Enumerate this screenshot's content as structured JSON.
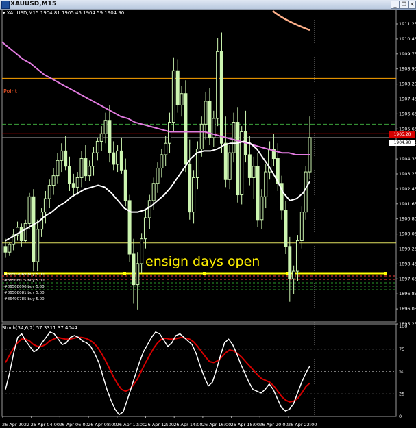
{
  "window": {
    "title": "XAUUSD,M15",
    "minimize_glyph": "_",
    "restore_glyph": "❐",
    "close_glyph": "✕"
  },
  "chart_header": "▾ XAUUSD,M15  1904.81 1905.45 1904.59 1904.90",
  "price_axis": [
    "1911.25",
    "1910.45",
    "1909.75",
    "1908.95",
    "1908.20",
    "1907.45",
    "1906.65",
    "1905.65",
    "1904.90",
    "1904.35",
    "1903.25",
    "1902.45",
    "1901.65",
    "1900.80",
    "1900.05",
    "1899.25",
    "1898.45",
    "1897.65",
    "1896.85",
    "1896.05",
    "1895.25"
  ],
  "current_price_tag": "1904.90",
  "red_price_tag": "1905.20",
  "point_label": "Point",
  "annotation": "ensign days open",
  "order_labels": [
    "#86502069 buy 5.00",
    "#86508075 buy 5.00",
    "#86508096 buy 5.00",
    "#86508081 buy 5.00",
    "#86490785 buy 5.00"
  ],
  "indicator_header": "Stoch(34,6,2) 57.3311 37.4044",
  "stoch_axis": [
    "100",
    "75",
    "50",
    "25",
    "0"
  ],
  "time_axis": [
    "26 Apr 2022",
    "26 Apr 04:00",
    "26 Apr 06:00",
    "26 Apr 08:00",
    "26 Apr 10:00",
    "26 Apr 12:00",
    "26 Apr 14:00",
    "26 Apr 16:00",
    "26 Apr 18:00",
    "26 Apr 20:00",
    "26 Apr 22:00"
  ],
  "colors": {
    "background": "#000000",
    "candle_body": "#ccf5b0",
    "ma_slow": "#e27be0",
    "ma_fast": "#ffffff",
    "trend": "#ffb08a",
    "level_orange": "#ffa500",
    "level_green": "#3ca23c",
    "stoch_main": "#ffffff",
    "stoch_signal": "#d40000",
    "annotation": "#fff000"
  },
  "chart_data": {
    "type": "candlestick",
    "symbol": "XAUUSD",
    "timeframe": "M15",
    "ylim": [
      1895.25,
      1911.6
    ],
    "candles": [
      [
        1899.2,
        1899.6,
        1898.6,
        1898.9
      ],
      [
        1898.9,
        1899.4,
        1898.7,
        1899.3
      ],
      [
        1899.3,
        1900.1,
        1899.0,
        1899.8
      ],
      [
        1899.8,
        1900.5,
        1899.5,
        1900.2
      ],
      [
        1900.2,
        1900.4,
        1899.2,
        1899.5
      ],
      [
        1899.5,
        1900.6,
        1899.4,
        1900.4
      ],
      [
        1900.4,
        1902.0,
        1900.1,
        1901.8
      ],
      [
        1901.8,
        1902.2,
        1897.9,
        1898.4
      ],
      [
        1898.4,
        1900.6,
        1897.9,
        1900.1
      ],
      [
        1900.1,
        1901.2,
        1899.7,
        1901.0
      ],
      [
        1901.0,
        1902.1,
        1900.4,
        1901.7
      ],
      [
        1901.7,
        1902.7,
        1901.2,
        1902.4
      ],
      [
        1902.4,
        1903.3,
        1901.9,
        1902.9
      ],
      [
        1902.9,
        1904.1,
        1902.5,
        1903.7
      ],
      [
        1903.7,
        1904.6,
        1903.1,
        1904.2
      ],
      [
        1904.2,
        1905.0,
        1903.2,
        1903.4
      ],
      [
        1903.4,
        1903.9,
        1902.1,
        1902.5
      ],
      [
        1902.5,
        1903.0,
        1901.8,
        1902.3
      ],
      [
        1902.3,
        1903.1,
        1901.9,
        1902.8
      ],
      [
        1902.8,
        1904.2,
        1902.3,
        1903.8
      ],
      [
        1903.8,
        1904.5,
        1902.6,
        1902.9
      ],
      [
        1902.9,
        1903.7,
        1902.6,
        1903.4
      ],
      [
        1903.4,
        1904.4,
        1902.9,
        1904.1
      ],
      [
        1904.1,
        1904.9,
        1903.7,
        1904.7
      ],
      [
        1904.7,
        1905.5,
        1904.2,
        1905.1
      ],
      [
        1905.1,
        1906.2,
        1904.6,
        1905.8
      ],
      [
        1905.8,
        1906.6,
        1903.6,
        1904.1
      ],
      [
        1904.1,
        1904.7,
        1903.2,
        1903.5
      ],
      [
        1903.5,
        1904.5,
        1903.1,
        1904.2
      ],
      [
        1904.2,
        1904.9,
        1903.0,
        1903.2
      ],
      [
        1903.2,
        1903.8,
        1901.3,
        1901.6
      ],
      [
        1901.6,
        1901.9,
        1898.4,
        1898.8
      ],
      [
        1898.8,
        1899.6,
        1896.2,
        1897.2
      ],
      [
        1897.2,
        1898.9,
        1895.9,
        1898.3
      ],
      [
        1898.3,
        1899.9,
        1897.8,
        1899.6
      ],
      [
        1899.6,
        1901.1,
        1899.1,
        1900.7
      ],
      [
        1900.7,
        1901.9,
        1900.1,
        1901.6
      ],
      [
        1901.6,
        1902.8,
        1901.1,
        1902.5
      ],
      [
        1902.5,
        1903.6,
        1902.0,
        1903.3
      ],
      [
        1903.3,
        1904.3,
        1902.8,
        1904.0
      ],
      [
        1904.0,
        1905.0,
        1903.4,
        1904.6
      ],
      [
        1904.6,
        1906.2,
        1904.1,
        1905.7
      ],
      [
        1905.7,
        1909.1,
        1905.2,
        1908.4
      ],
      [
        1908.4,
        1909.0,
        1906.2,
        1906.6
      ],
      [
        1906.6,
        1907.6,
        1906.0,
        1907.2
      ],
      [
        1907.2,
        1907.9,
        1903.1,
        1903.5
      ],
      [
        1903.5,
        1904.8,
        1900.6,
        1901.0
      ],
      [
        1901.0,
        1903.2,
        1900.4,
        1902.8
      ],
      [
        1902.8,
        1904.7,
        1902.2,
        1904.3
      ],
      [
        1904.3,
        1906.0,
        1903.9,
        1905.6
      ],
      [
        1905.6,
        1907.3,
        1904.8,
        1906.8
      ],
      [
        1906.8,
        1907.5,
        1904.5,
        1904.9
      ],
      [
        1904.9,
        1906.3,
        1904.4,
        1905.9
      ],
      [
        1905.9,
        1910.1,
        1905.5,
        1909.4
      ],
      [
        1909.4,
        1910.4,
        1904.1,
        1904.6
      ],
      [
        1904.6,
        1906.0,
        1902.3,
        1902.7
      ],
      [
        1902.7,
        1904.5,
        1902.2,
        1904.1
      ],
      [
        1904.1,
        1906.2,
        1903.6,
        1905.7
      ],
      [
        1905.7,
        1906.5,
        1901.5,
        1901.9
      ],
      [
        1901.9,
        1905.5,
        1901.4,
        1905.2
      ],
      [
        1905.2,
        1906.3,
        1903.6,
        1904.0
      ],
      [
        1904.0,
        1905.0,
        1902.4,
        1902.8
      ],
      [
        1902.8,
        1903.9,
        1901.7,
        1903.4
      ],
      [
        1903.4,
        1904.1,
        1900.2,
        1900.6
      ],
      [
        1900.6,
        1902.2,
        1900.1,
        1901.8
      ],
      [
        1901.8,
        1903.5,
        1901.2,
        1903.1
      ],
      [
        1903.1,
        1904.7,
        1902.7,
        1904.3
      ],
      [
        1904.3,
        1905.1,
        1903.4,
        1903.8
      ],
      [
        1903.8,
        1904.6,
        1902.1,
        1902.5
      ],
      [
        1902.5,
        1902.9,
        1900.6,
        1901.1
      ],
      [
        1901.1,
        1901.6,
        1898.8,
        1899.2
      ],
      [
        1899.2,
        1899.7,
        1896.3,
        1897.5
      ],
      [
        1897.5,
        1898.2,
        1896.7,
        1897.9
      ],
      [
        1897.9,
        1899.8,
        1897.4,
        1899.5
      ],
      [
        1899.5,
        1901.3,
        1899.1,
        1901.0
      ],
      [
        1901.0,
        1903.4,
        1900.6,
        1903.1
      ],
      [
        1903.1,
        1906.0,
        1902.7,
        1904.9
      ]
    ],
    "ma_slow": [
      1909.9,
      1909.6,
      1909.3,
      1909.0,
      1908.8,
      1908.5,
      1908.2,
      1908.0,
      1907.8,
      1907.6,
      1907.4,
      1907.2,
      1907.0,
      1906.8,
      1906.6,
      1906.4,
      1906.2,
      1906.0,
      1905.9,
      1905.7,
      1905.6,
      1905.5,
      1905.4,
      1905.3,
      1905.2,
      1905.2,
      1905.2,
      1905.2,
      1905.2,
      1905.2,
      1905.1,
      1905.0,
      1904.9,
      1904.8,
      1904.7,
      1904.6,
      1904.5,
      1904.4,
      1904.3,
      1904.2,
      1904.1,
      1904.1,
      1904.0,
      1904.0,
      1904.0
    ],
    "ma_fast": [
      1899.5,
      1899.7,
      1899.9,
      1900.1,
      1900.3,
      1900.5,
      1900.8,
      1901.0,
      1901.3,
      1901.5,
      1901.8,
      1902.0,
      1902.2,
      1902.3,
      1902.4,
      1902.3,
      1902.0,
      1901.6,
      1901.2,
      1901.0,
      1901.0,
      1901.1,
      1901.3,
      1901.6,
      1901.9,
      1902.3,
      1902.8,
      1903.3,
      1903.8,
      1904.1,
      1904.2,
      1904.2,
      1904.3,
      1904.5,
      1904.6,
      1904.6,
      1904.7,
      1904.6,
      1904.3,
      1903.8,
      1903.3,
      1902.7,
      1902.0,
      1901.6,
      1901.7,
      1902.0,
      1902.6
    ],
    "levels": {
      "orange": 1908.0,
      "green_dash": 1905.6,
      "red": 1905.1,
      "gray": 1904.9,
      "yellow": 1898.45
    },
    "stochastic": {
      "params": "34,6,2",
      "main": 57.3311,
      "signal": 37.4044,
      "ylim": [
        0,
        100
      ],
      "main_series": [
        30,
        48,
        70,
        88,
        92,
        84,
        78,
        72,
        75,
        82,
        88,
        94,
        92,
        86,
        80,
        82,
        88,
        90,
        88,
        84,
        82,
        78,
        70,
        60,
        45,
        30,
        18,
        8,
        2,
        5,
        18,
        32,
        46,
        60,
        72,
        80,
        88,
        94,
        92,
        85,
        78,
        82,
        90,
        92,
        88,
        84,
        80,
        70,
        56,
        44,
        34,
        38,
        52,
        68,
        82,
        86,
        80,
        70,
        58,
        48,
        38,
        30,
        28,
        26,
        30,
        36,
        30,
        20,
        10,
        6,
        8,
        14,
        26,
        38,
        48,
        56
      ],
      "signal_series": [
        60,
        68,
        76,
        82,
        86,
        86,
        84,
        80,
        78,
        78,
        80,
        84,
        86,
        88,
        87,
        86,
        86,
        87,
        88,
        88,
        87,
        85,
        82,
        77,
        70,
        62,
        53,
        44,
        36,
        30,
        28,
        30,
        35,
        42,
        51,
        60,
        68,
        76,
        82,
        86,
        87,
        86,
        86,
        87,
        88,
        87,
        86,
        83,
        78,
        72,
        66,
        61,
        60,
        62,
        66,
        71,
        74,
        73,
        70,
        66,
        61,
        56,
        51,
        46,
        42,
        40,
        38,
        34,
        28,
        22,
        18,
        16,
        17,
        20,
        26,
        33,
        37
      ]
    }
  }
}
